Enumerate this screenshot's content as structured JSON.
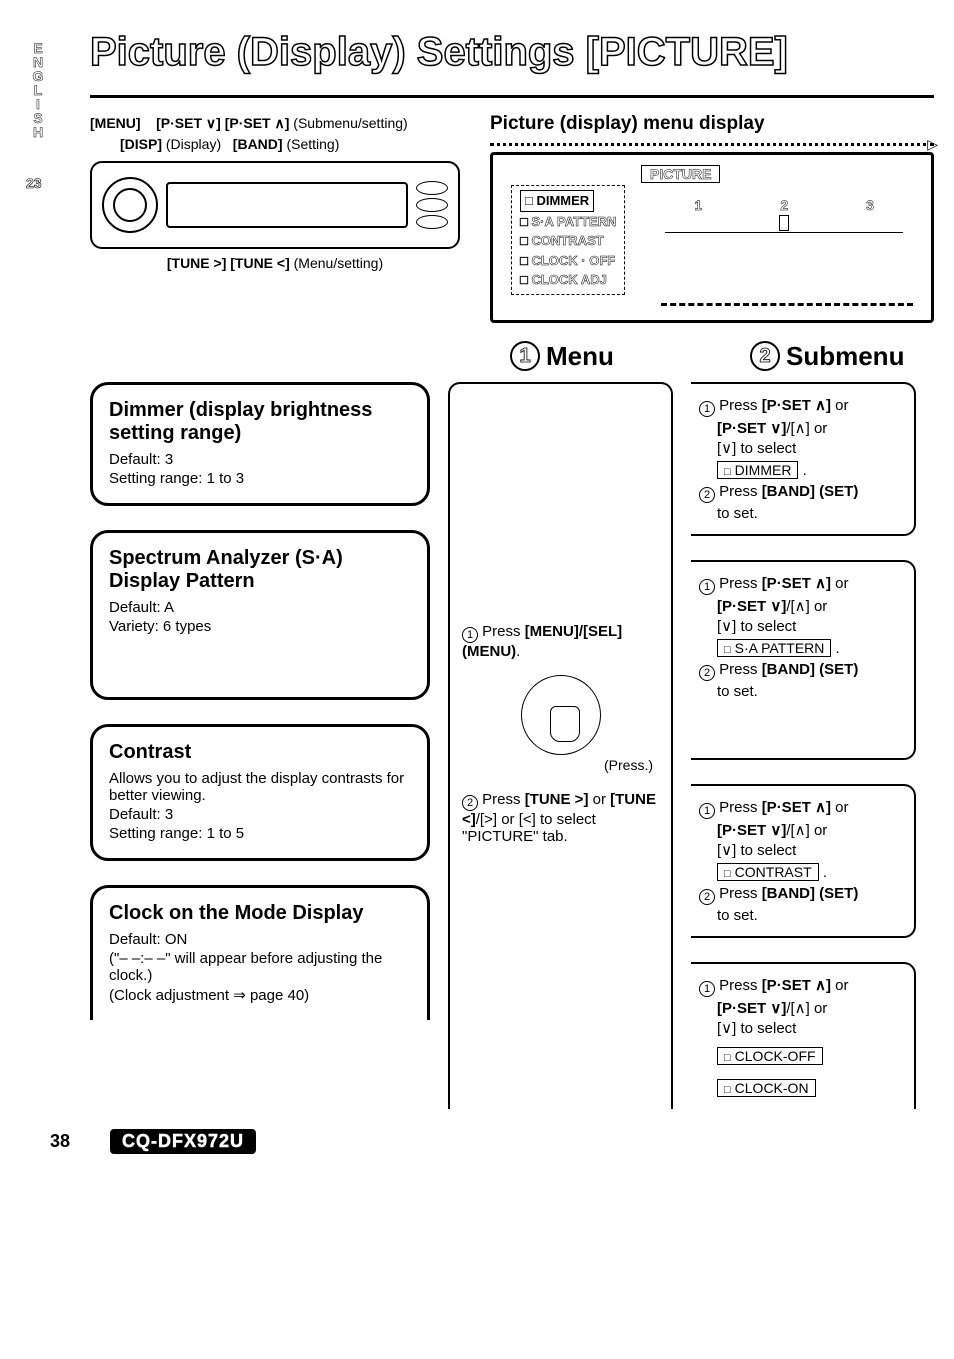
{
  "sidebar": {
    "language": "ENGLISH",
    "pageBadge": "23"
  },
  "title": "Picture (Display) Settings [PICTURE]",
  "topLeft": {
    "line1": {
      "a": "[MENU]",
      "b": "[P·SET ∨] [P·SET ∧]",
      "c": "(Submenu/setting)"
    },
    "line2": {
      "a": "[DISP]",
      "b": "(Display)",
      "c": "[BAND]",
      "d": "(Setting)"
    },
    "bottom": {
      "a": "[TUNE >] [TUNE <]",
      "b": "(Menu/setting)"
    }
  },
  "topRight": {
    "subtitle": "Picture (display) menu display",
    "tab": "PICTURE",
    "items": [
      "DIMMER",
      "S·A PATTERN",
      "CONTRAST",
      "CLOCK · OFF",
      "CLOCK   ADJ"
    ],
    "sliderNums": [
      "1",
      "2",
      "3"
    ]
  },
  "heads": {
    "menu": "Menu",
    "submenu": "Submenu",
    "n1": "1",
    "n2": "2"
  },
  "leftBoxes": [
    {
      "title": "Dimmer (display brightness setting range)",
      "lines": [
        "Default: 3",
        "Setting range: 1 to 3"
      ]
    },
    {
      "title": "Spectrum Analyzer (S·A) Display Pattern",
      "lines": [
        "Default: A",
        "Variety: 6 types"
      ]
    },
    {
      "title": "Contrast",
      "lines": [
        "Allows you to adjust the display contrasts for better viewing.",
        "Default: 3",
        "Setting range: 1 to 5"
      ]
    },
    {
      "title": "Clock on the Mode Display",
      "lines": [
        "Default: ON"
      ],
      "indent": [
        "(\"– –:– –\" will appear before adjusting the clock.)",
        "(Clock adjustment ⇒ page 40)"
      ]
    }
  ],
  "midCol": {
    "step1": {
      "num": "1",
      "pre": "Press ",
      "bold": "[MENU]/[SEL] (MENU)",
      "post": "."
    },
    "press": "(Press.)",
    "step2": {
      "num": "2",
      "pre": "Press ",
      "bold1": "[TUNE >]",
      "mid": " or ",
      "bold2": "[TUNE <]",
      "post": "/[>] or [<] to select \"PICTURE\" tab."
    }
  },
  "rightBoxes": [
    {
      "l1": {
        "num": "1",
        "pre": "Press ",
        "bold": "[P·SET ∧]",
        "post": " or"
      },
      "l2": {
        "bold": "[P·SET ∨]",
        "post": "/[∧] or"
      },
      "l3": "[∨] to select",
      "pill": "DIMMER",
      "l5": {
        "num": "2",
        "pre": "Press ",
        "bold": "[BAND] (SET)",
        "post": ""
      },
      "l6": "to set."
    },
    {
      "l1": {
        "num": "1",
        "pre": "Press ",
        "bold": "[P·SET ∧]",
        "post": " or"
      },
      "l2": {
        "bold": "[P·SET ∨]",
        "post": "/[∧] or"
      },
      "l3": "[∨] to select",
      "pill": "S·A PATTERN",
      "l5": {
        "num": "2",
        "pre": "Press ",
        "bold": "[BAND] (SET)",
        "post": ""
      },
      "l6": "to set."
    },
    {
      "l1": {
        "num": "1",
        "pre": "Press ",
        "bold": "[P·SET ∧]",
        "post": " or"
      },
      "l2": {
        "bold": "[P·SET ∨]",
        "post": "/[∧] or"
      },
      "l3": "[∨] to select",
      "pill": "CONTRAST",
      "l5": {
        "num": "2",
        "pre": "Press ",
        "bold": "[BAND] (SET)",
        "post": ""
      },
      "l6": "to set."
    },
    {
      "l1": {
        "num": "1",
        "pre": "Press ",
        "bold": "[P·SET ∧]",
        "post": " or"
      },
      "l2": {
        "bold": "[P·SET ∨]",
        "post": "/[∧] or"
      },
      "l3": "[∨] to select",
      "pills": [
        "CLOCK-OFF",
        "CLOCK-ON"
      ]
    }
  ],
  "footer": {
    "pageNum": "38",
    "model": "CQ-DFX972U"
  }
}
